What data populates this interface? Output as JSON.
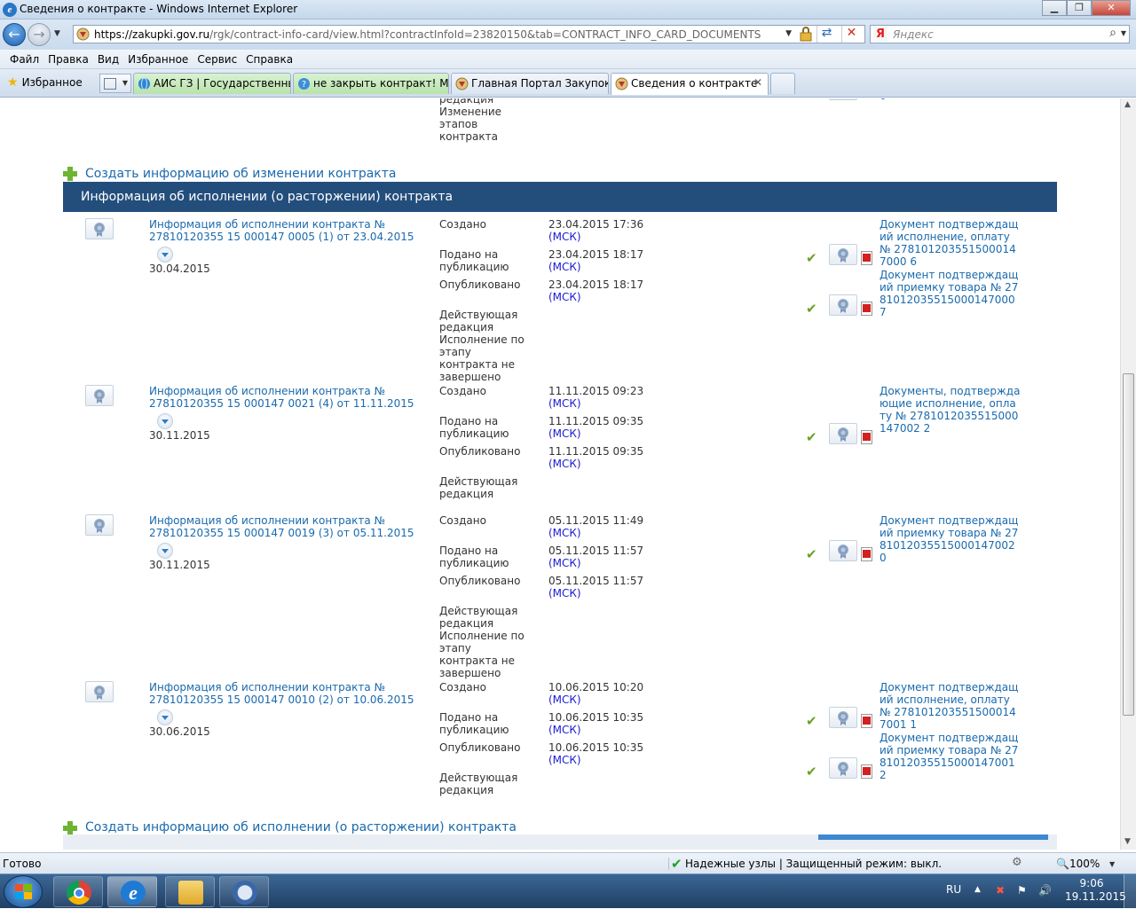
{
  "window": {
    "title": "Сведения о контракте - Windows Internet Explorer",
    "minimize": "▁",
    "restore": "❐",
    "close": "✕"
  },
  "address": {
    "url_host": "https://zakupki.gov.ru",
    "url_path": "/rgk/contract-info-card/view.html?contractInfoId=23820150&tab=CONTRACT_INFO_CARD_DOCUMENTS",
    "search_placeholder": "Яндекс",
    "search_logo": "Я"
  },
  "menu": [
    "Файл",
    "Правка",
    "Вид",
    "Избранное",
    "Сервис",
    "Справка"
  ],
  "favorites_label": "Избранное",
  "tabs": [
    {
      "label": "АИС ГЗ | Государственны..."
    },
    {
      "label": "не закрыть контракт! Мо..."
    },
    {
      "label": "Главная Портал Закупок"
    },
    {
      "label": "Сведения о контракте"
    }
  ],
  "top_partial": {
    "lines": [
      "редакция",
      "Изменение",
      "этапов",
      "контракта"
    ],
    "link_fragment": "6"
  },
  "create_change_link": "Создать информацию об изменении контракта",
  "section_title": "Информация об исполнении (о расторжении) контракта",
  "msk": "(МСК)",
  "labels": {
    "created": "Создано",
    "submitted": "Подано на публикацию",
    "published": "Опубликовано",
    "current": "Действующая редакция"
  },
  "records": [
    {
      "title": "Информация об исполнении контракта № 27810120355 15 000147 0005 (1) от 23.04.2015",
      "date": "30.04.2015",
      "created": "23.04.2015 17:36",
      "submitted": "23.04.2015 18:17",
      "published": "23.04.2015 18:17",
      "status": "Действующая редакция Исполнение по этапу контракта не завершено",
      "docs": [
        {
          "title": "Документ подтверждащий исполнение, оплату № 2781012035515000147000 6"
        },
        {
          "title": "Документ подтверждащий приемку товара № 2781012035515000147000 7"
        }
      ]
    },
    {
      "title": "Информация об исполнении контракта № 27810120355 15 000147 0021 (4) от 11.11.2015",
      "date": "30.11.2015",
      "created": "11.11.2015 09:23",
      "submitted": "11.11.2015 09:35",
      "published": "11.11.2015 09:35",
      "status": "Действующая редакция",
      "docs": [
        {
          "title": "Документы, подтверждающие исполнение, оплату № 2781012035515000147002 2"
        }
      ]
    },
    {
      "title": "Информация об исполнении контракта № 27810120355 15 000147 0019 (3) от 05.11.2015",
      "date": "30.11.2015",
      "created": "05.11.2015 11:49",
      "submitted": "05.11.2015 11:57",
      "published": "05.11.2015 11:57",
      "status": "Действующая редакция Исполнение по этапу контракта не завершено",
      "docs": [
        {
          "title": "Документ подтверждащий приемку товара № 2781012035515000147002 0"
        }
      ]
    },
    {
      "title": "Информация об исполнении контракта № 27810120355 15 000147 0010 (2) от 10.06.2015",
      "date": "30.06.2015",
      "created": "10.06.2015 10:20",
      "submitted": "10.06.2015 10:35",
      "published": "10.06.2015 10:35",
      "status": "Действующая редакция",
      "docs": [
        {
          "title": "Документ подтверждащий исполнение, оплату № 2781012035515000147001 1"
        },
        {
          "title": "Документ подтверждащий приемку товара № 2781012035515000147001 2"
        }
      ]
    }
  ],
  "create_execution_link": "Создать информацию об исполнении (о расторжении) контракта",
  "status": {
    "ready": "Готово",
    "zone": "Надежные узлы | Защищенный режим: выкл.",
    "zoom": "100%"
  },
  "taskbar": {
    "lang": "RU",
    "time": "9:06",
    "date": "19.11.2015"
  }
}
